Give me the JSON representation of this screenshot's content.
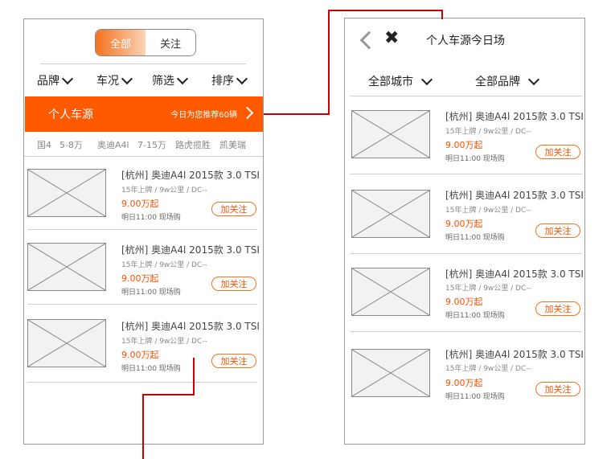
{
  "left": {
    "toggle": {
      "all": "全部",
      "follow": "关注"
    },
    "filters": [
      "品牌",
      "车况",
      "筛选",
      "排序"
    ],
    "banner": {
      "title": "个人车源",
      "recommend": "今日为您推荐60辆"
    },
    "tags": [
      "国4",
      "5-8万",
      "奥迪A4l",
      "7-15万",
      "路虎揽胜",
      "凯美瑞"
    ],
    "cards": [
      {
        "title": "[杭州] 奥迪A4l 2015款 3.0 TSI",
        "sub": "15年上牌 / 9w公里 / DC--",
        "price": "9.00万起",
        "when": "明日11:00 现场购",
        "button": "加关注"
      },
      {
        "title": "[杭州] 奥迪A4l 2015款 3.0 TSI",
        "sub": "15年上牌 / 9w公里 / DC--",
        "price": "9.00万起",
        "when": "明日11:00 现场购",
        "button": "加关注"
      },
      {
        "title": "[杭州] 奥迪A4l 2015款 3.0 TSI",
        "sub": "15年上牌 / 9w公里 / DC--",
        "price": "9.00万起",
        "when": "明日11:00 现场购",
        "button": "加关注"
      }
    ]
  },
  "right": {
    "title": "个人车源今日场",
    "filters": [
      "全部城市",
      "全部品牌"
    ],
    "cards": [
      {
        "title": "[杭州] 奥迪A4l 2015款 3.0 TSI",
        "sub": "15年上牌 / 9w公里 / DC--",
        "price": "9.00万起",
        "when": "明日11:00 现场购",
        "button": "加关注"
      },
      {
        "title": "[杭州] 奥迪A4l 2015款 3.0 TSI",
        "sub": "15年上牌 / 9w公里 / DC--",
        "price": "9.00万起",
        "when": "明日11:00 现场购",
        "button": "加关注"
      },
      {
        "title": "[杭州] 奥迪A4l 2015款 3.0 TSI",
        "sub": "15年上牌 / 9w公里 / DC--",
        "price": "9.00万起",
        "when": "明日11:00 现场购",
        "button": "加关注"
      },
      {
        "title": "[杭州] 奥迪A4l 2015款 3.0 TSI",
        "sub": "15年上牌 / 9w公里 / DC--",
        "price": "9.00万起",
        "when": "明日11:00 现场购",
        "button": "加关注"
      }
    ]
  },
  "colors": {
    "accent": "#ff5a00",
    "connector": "#cc0000"
  }
}
